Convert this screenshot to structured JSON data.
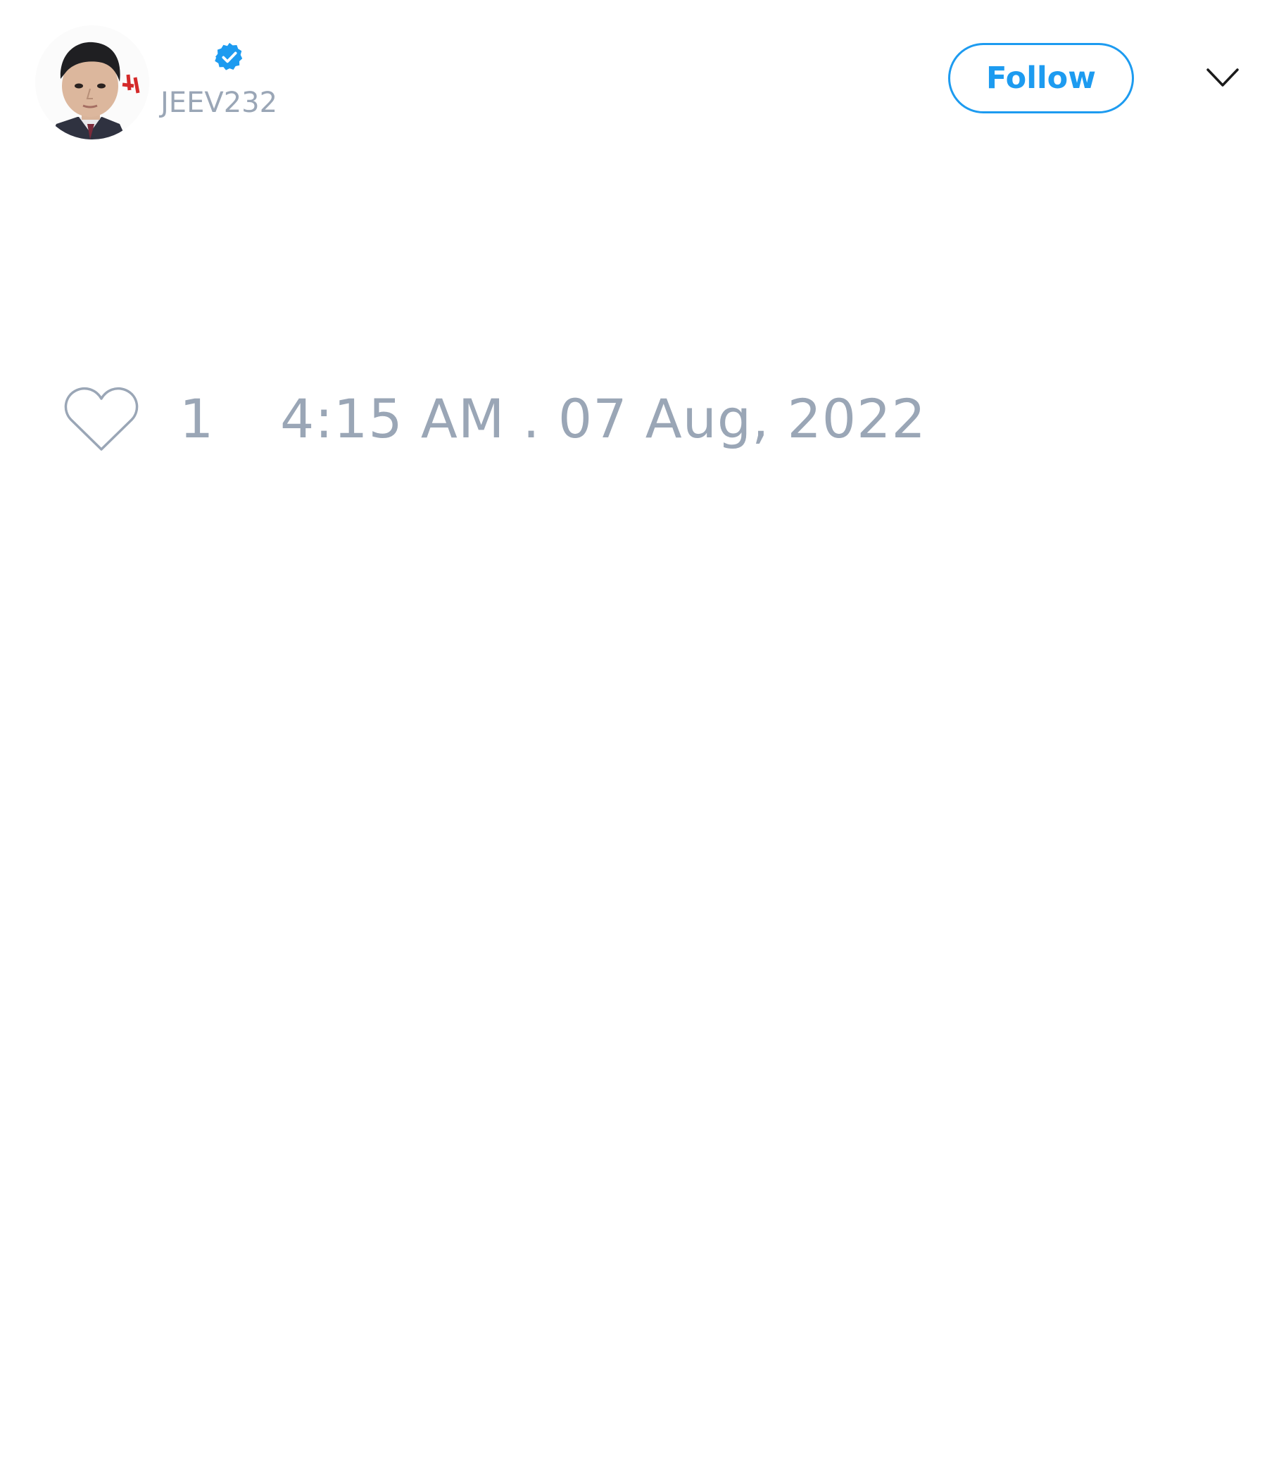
{
  "author": {
    "handle": "JEEV232",
    "verified": true,
    "avatar": "profile-photo"
  },
  "header": {
    "follow_label": "Follow",
    "menu_icon": "chevron-down-icon"
  },
  "tweet": {
    "like_icon": "heart-icon",
    "like_count": "1",
    "timestamp": "4:15 AM . 07 Aug, 2022"
  },
  "colors": {
    "accent": "#1d9bf0",
    "muted_text": "#9aa6b6",
    "background": "#ffffff"
  }
}
